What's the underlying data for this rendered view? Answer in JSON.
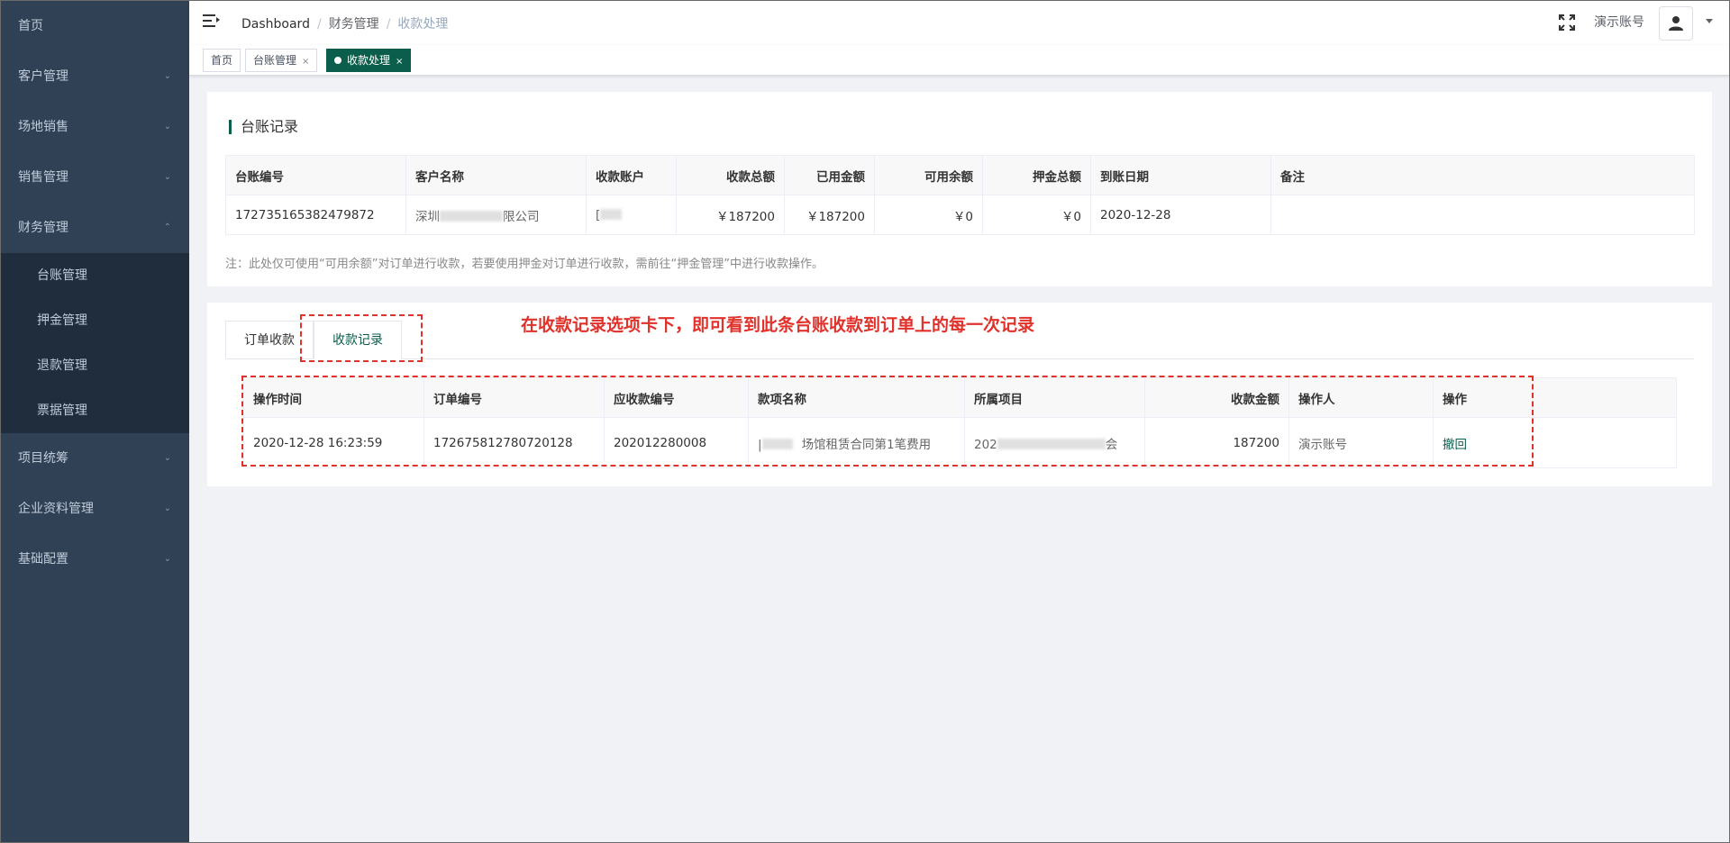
{
  "sidebar": {
    "items": [
      {
        "label": "首页"
      },
      {
        "label": "客户管理"
      },
      {
        "label": "场地销售"
      },
      {
        "label": "销售管理"
      },
      {
        "label": "财务管理"
      },
      {
        "label": "项目统筹"
      },
      {
        "label": "企业资料管理"
      },
      {
        "label": "基础配置"
      }
    ],
    "finance_sub": [
      {
        "label": "台账管理"
      },
      {
        "label": "押金管理"
      },
      {
        "label": "退款管理"
      },
      {
        "label": "票据管理"
      }
    ]
  },
  "header": {
    "breadcrumb": [
      "Dashboard",
      "财务管理",
      "收款处理"
    ],
    "username": "演示账号"
  },
  "tags": [
    {
      "label": "首页"
    },
    {
      "label": "台账管理"
    },
    {
      "label": "收款处理"
    }
  ],
  "ledger": {
    "title": "台账记录",
    "columns": [
      "台账编号",
      "客户名称",
      "收款账户",
      "收款总额",
      "已用金额",
      "可用余额",
      "押金总额",
      "到账日期",
      "备注"
    ],
    "row": {
      "id": "172735165382479872",
      "customer_prefix": "深圳",
      "customer_suffix": "限公司",
      "account": "[",
      "total": "￥187200",
      "used": "￥187200",
      "available": "￥0",
      "deposit": "￥0",
      "date": "2020-12-28",
      "remark": ""
    },
    "note": "注：此处仅可使用“可用余额”对订单进行收款，若要使用押金对订单进行收款，需前往“押金管理”中进行收款操作。"
  },
  "tabs": [
    {
      "label": "订单收款"
    },
    {
      "label": "收款记录"
    }
  ],
  "records": {
    "columns": [
      "操作时间",
      "订单编号",
      "应收款编号",
      "款项名称",
      "所属项目",
      "收款金额",
      "操作人",
      "操作"
    ],
    "row": {
      "time": "2020-12-28 16:23:59",
      "order_no": "172675812780720128",
      "receivable_no": "202012280008",
      "item_name_prefix": "|",
      "item_name_suffix": "场馆租赁合同第1笔费用",
      "project_prefix": "202",
      "project_suffix": "会",
      "amount": "187200",
      "operator": "演示账号",
      "action": "撤回"
    }
  },
  "annotation": "在收款记录选项卡下，即可看到此条台账收款到订单上的每一次记录",
  "colors": {
    "sidebar": "#304156",
    "submenu": "#1f2d3d",
    "accent": "#0b5e4c",
    "annotation": "#e0312b"
  }
}
